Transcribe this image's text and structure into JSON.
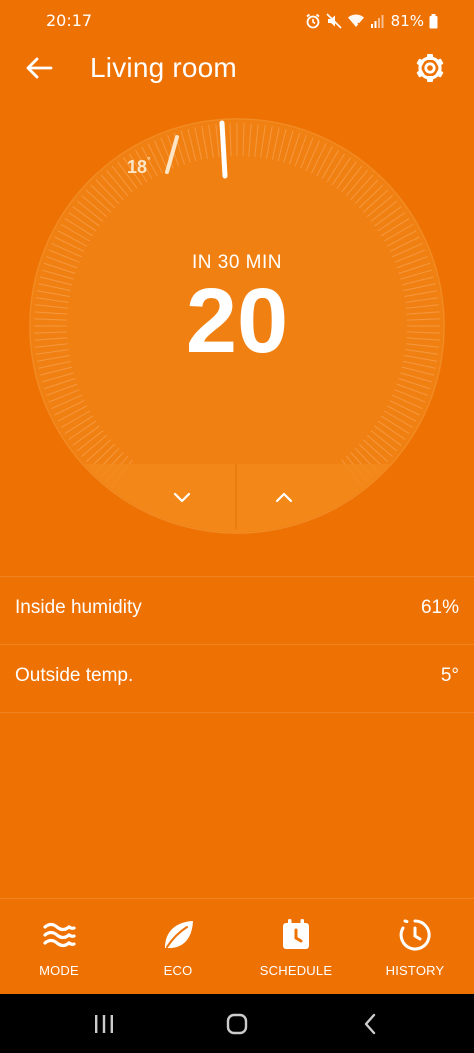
{
  "status_bar": {
    "time": "20:17",
    "battery": "81%",
    "icons": [
      "alarm-icon",
      "mute-icon",
      "wifi-icon",
      "signal-icon",
      "battery-icon"
    ]
  },
  "header": {
    "title": "Living room",
    "back_icon": "arrow-left-icon",
    "settings_icon": "gear-icon"
  },
  "thermostat": {
    "status": "IN 30 MIN",
    "target_temp": "20",
    "current_setpoint": "18",
    "current_setpoint_unit": "°",
    "down_icon": "chevron-down-icon",
    "up_icon": "chevron-up-icon"
  },
  "info": [
    {
      "label": "Inside humidity",
      "value": "61%"
    },
    {
      "label": "Outside temp.",
      "value": "5°"
    }
  ],
  "bottom_nav": [
    {
      "label": "MODE",
      "icon": "waves-icon"
    },
    {
      "label": "ECO",
      "icon": "leaf-icon"
    },
    {
      "label": "SCHEDULE",
      "icon": "calendar-clock-icon"
    },
    {
      "label": "HISTORY",
      "icon": "history-icon"
    }
  ],
  "system_nav": {
    "icons": [
      "recents-icon",
      "home-icon",
      "back-icon"
    ]
  },
  "colors": {
    "background": "#ee7103",
    "dial": "#f18012",
    "accent_light": "#fde6c7"
  }
}
